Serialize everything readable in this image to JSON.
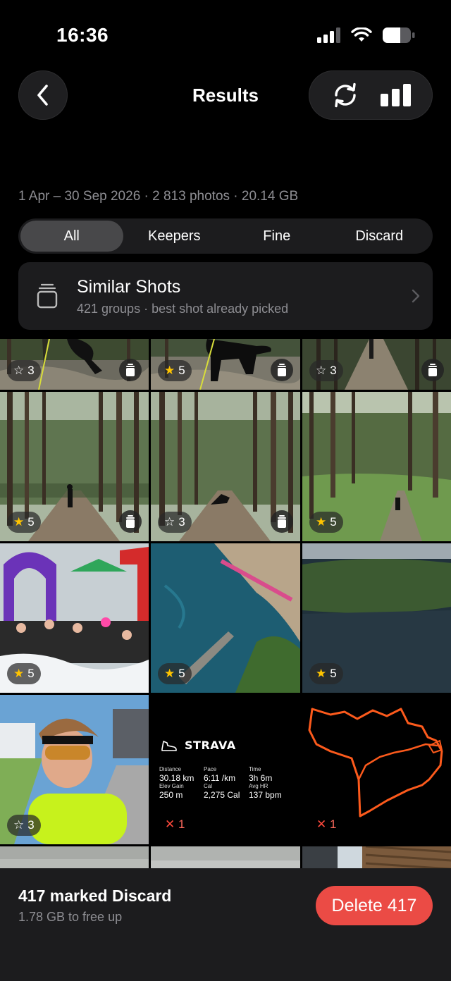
{
  "status": {
    "time": "16:36"
  },
  "nav": {
    "title": "Results",
    "back_icon": "chevron-left-icon",
    "sync_icon": "sync-icon",
    "chart_icon": "bar-chart-icon"
  },
  "summary": "1 Apr – 30 Sep 2026 · 2 813 photos · 20.14 GB",
  "tabs": [
    {
      "label": "All",
      "active": true
    },
    {
      "label": "Keepers"
    },
    {
      "label": "Fine"
    },
    {
      "label": "Discard"
    }
  ],
  "similar": {
    "title": "Similar Shots",
    "subtitle": "421 groups · best shot already picked"
  },
  "photos": [
    {
      "rating": "3",
      "star": "outline",
      "bin": true
    },
    {
      "rating": "5",
      "star": "gold",
      "bin": true
    },
    {
      "rating": "3",
      "star": "outline",
      "bin": true
    },
    {
      "rating": "5",
      "star": "gold",
      "bin": true
    },
    {
      "rating": "3",
      "star": "outline",
      "bin": true
    },
    {
      "rating": "5",
      "star": "gold",
      "bin": false
    },
    {
      "rating": "5",
      "star": "gold",
      "bin": false
    },
    {
      "rating": "5",
      "star": "gold",
      "bin": false
    },
    {
      "rating": "5",
      "star": "gold",
      "bin": false
    },
    {
      "rating": "3",
      "star": "outline",
      "bin": false
    },
    {
      "discard": "1"
    },
    {
      "discard": "1"
    }
  ],
  "strava": {
    "brand": "STRAVA",
    "stats": [
      {
        "label": "Distance",
        "value": "30.18 km"
      },
      {
        "label": "Pace",
        "value": "6:11 /km"
      },
      {
        "label": "Time",
        "value": "3h 6m"
      },
      {
        "label": "Elev Gain",
        "value": "250 m"
      },
      {
        "label": "Cal",
        "value": "2,275 Cal"
      },
      {
        "label": "Avg HR",
        "value": "137 bpm"
      }
    ]
  },
  "bottom": {
    "title": "417 marked Discard",
    "subtitle": "1.78 GB to free up",
    "delete_label": "Delete 417"
  },
  "colors": {
    "accent_delete": "#eb4b45",
    "star_gold": "#ffc400",
    "discard_red": "#ff4a3d",
    "strava_orange": "#fc4c02"
  }
}
